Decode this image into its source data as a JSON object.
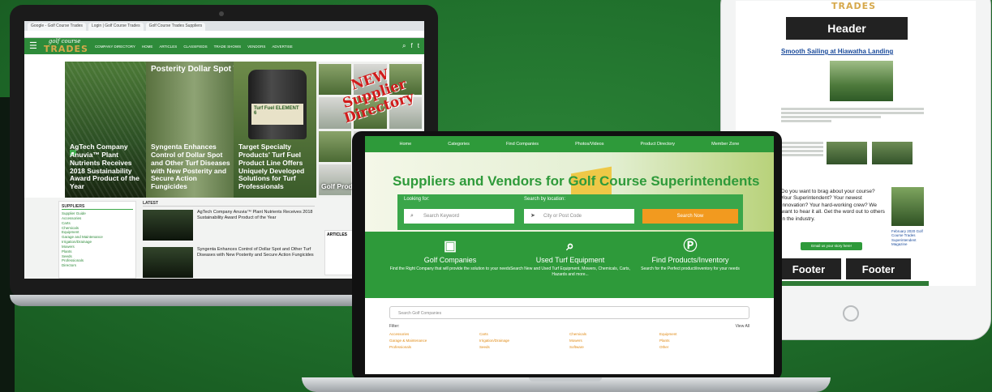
{
  "laptop_left": {
    "browser_tabs": [
      "Google - Golf Course Trades",
      "Login | Golf Course Trades",
      "Golf Course Trades Suppliers"
    ],
    "nav": {
      "logo_small": "golf course",
      "logo_big": "TRADES",
      "items": [
        "COMPANY DIRECTORY",
        "HOME",
        "ARTICLES",
        "CLASSIFIEDS",
        "TRADE SHOWS",
        "VENDORS",
        "ADVERTISE"
      ]
    },
    "hero": [
      {
        "tag": "",
        "title": "AgTech Company Anuvia™ Plant Nutrients Receives 2018 Sustainability Award Product of the Year"
      },
      {
        "heading": "Posterity Dollar Spot Tri",
        "title": "Syngenta Enhances Control of Dollar Spot and Other Turf Diseases with New Posterity and Secure Action Fungicides"
      },
      {
        "label": "Turf Fuel ELEMENT 6",
        "title": "Target Specialty Products' Turf Fuel Product Line Offers Uniquely Developed Solutions for Turf Professionals"
      },
      {
        "overlay": "NEW Supplier Directory",
        "title": "Golf Product Directory"
      }
    ],
    "sidebar": {
      "heading": "SUPPLIERS",
      "links": [
        "Supplier Guide",
        "Accessories",
        "Carts",
        "Chemicals",
        "Equipment",
        "Garage and Maintenance",
        "Irrigation/Drainage",
        "Mowers",
        "Plants",
        "Seeds",
        "Professionals",
        "Directors"
      ]
    },
    "latest": {
      "heading": "LATEST",
      "items": [
        "AgTech Company Anuvia™ Plant Nutrients Receives 2018 Sustainability Award Product of the Year",
        "Syngenta Enhances Control of Dollar Spot and Other Turf Diseases with New Posterity and Secure Action Fungicides"
      ]
    },
    "articles_heading": "ARTICLES"
  },
  "laptop_center": {
    "nav": [
      "Home",
      "Categories",
      "Find Companies",
      "Photos/Videos",
      "Product Directory",
      "Member Zone"
    ],
    "headline": "Suppliers and Vendors for Golf Course Superintendents",
    "search": {
      "looking_label": "Looking for:",
      "looking_placeholder": "Search Keyword",
      "location_label": "Search by location:",
      "location_placeholder": "City or Post Code",
      "button": "Search Now"
    },
    "features": [
      {
        "icon": "id-card-icon",
        "title": "Golf Companies",
        "desc": "Find the Right Company that will provide the solution to your needs"
      },
      {
        "icon": "magnifier-icon",
        "title": "Used Turf Equipment",
        "desc": "Search New and Used Turf Equipment, Mowers, Chemicals, Carts, Hazards and more..."
      },
      {
        "icon": "product-p-icon",
        "title": "Find Products/Inventory",
        "desc": "Search for the Perfect product/inventory for your needs"
      }
    ],
    "search_companies_placeholder": "Search Golf Companies",
    "filter_label": "Filter:",
    "view_all": "View All",
    "categories": [
      "Accessories",
      "Carts",
      "Chemicals",
      "Equipment",
      "Garage & Maintenance",
      "Irrigation/Drainage",
      "Mowers",
      "Plants",
      "Professionals",
      "Seeds",
      "Software",
      "Other"
    ]
  },
  "tablet": {
    "logo": "TRADES",
    "header_label": "Header",
    "story_title": "Smooth Sailing at Hiawatha Landing",
    "question": "Do you want to brag about your course? Your Superintendent? Your newest innovation? Your hard-working crew? We want to hear it all. Get the word out to others in the industry.",
    "cta_button": "Email us your story here!",
    "book_caption": "February 2020 Golf Course Trades Superintendent Magazine",
    "footer_labels": [
      "Footer",
      "Footer"
    ]
  }
}
